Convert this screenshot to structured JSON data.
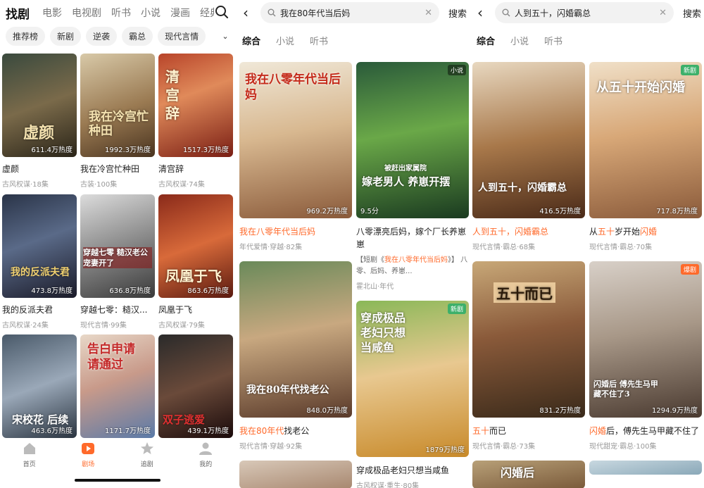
{
  "panel1": {
    "nav_tabs": [
      "找剧",
      "电影",
      "电视剧",
      "听书",
      "小说",
      "漫画",
      "经典"
    ],
    "chips": [
      "推荐榜",
      "新剧",
      "逆袭",
      "霸总",
      "现代言情"
    ],
    "grid": [
      {
        "title": "虚颜",
        "meta": "古风权谋·18集",
        "heat": "611.4万热度",
        "poster_text": "虚颜"
      },
      {
        "title": "我在冷宫忙种田",
        "meta": "古装·100集",
        "heat": "1992.3万热度",
        "poster_text": "我在冷宫忙种田"
      },
      {
        "title": "清宫辞",
        "meta": "古风权谋·74集",
        "heat": "1517.3万热度",
        "poster_text": "清宫辞"
      },
      {
        "title": "我的反派夫君",
        "meta": "古风权谋·24集",
        "heat": "473.8万热度",
        "poster_text": "我的反派夫君"
      },
      {
        "title": "穿越七零：糙汉...",
        "meta": "现代言情·99集",
        "heat": "636.8万热度",
        "poster_text": "穿越七零 糙汉老公宠妻开了"
      },
      {
        "title": "凤凰于飞",
        "meta": "古风权谋·79集",
        "heat": "863.6万热度",
        "poster_text": "凤凰于飞"
      },
      {
        "title": "",
        "meta": "",
        "heat": "463.6万热度",
        "poster_text": "宋校花 后续"
      },
      {
        "title": "",
        "meta": "",
        "heat": "1171.7万热度",
        "poster_text": "告白申请 请通过"
      },
      {
        "title": "",
        "meta": "",
        "heat": "439.1万热度",
        "poster_text": "双子逃爱"
      }
    ],
    "tabbar": [
      {
        "label": "首页",
        "active": false
      },
      {
        "label": "剧场",
        "active": true
      },
      {
        "label": "追剧",
        "active": false
      },
      {
        "label": "我的",
        "active": false
      }
    ]
  },
  "panel2": {
    "query": "我在80年代当后妈",
    "search_label": "搜索",
    "tabs": [
      "综合",
      "小说",
      "听书"
    ],
    "left": [
      {
        "title_parts": [
          [
            "我在八零",
            "hl"
          ],
          [
            "年代当后妈",
            "hl"
          ]
        ],
        "meta": "年代爱情·穿越·82集",
        "heat": "969.2万热度",
        "poster_text": "我在八零年代当后妈",
        "tag": ""
      },
      {
        "title_parts": [
          [
            "我在80年代",
            "hl"
          ],
          [
            "找老公",
            ""
          ]
        ],
        "meta": "现代言情·穿越·92集",
        "heat": "848.0万热度",
        "poster_text": "我在80年代找老公",
        "tag": ""
      }
    ],
    "right": [
      {
        "title": "八零漂亮后妈，嫁个厂长养崽崽",
        "title_hl": "后妈",
        "snippet_prefix": "【短剧《",
        "snippet_hl": "我在八零年代当后妈",
        "snippet_suffix": "》】 八零、后妈、养崽...",
        "meta": "霍北山·年代",
        "heat": "9.5分",
        "poster_text": "嫁老男人 养崽开摆",
        "poster_sub": "被赶出家属院",
        "tag": "小说"
      },
      {
        "title": "穿成极品老妇只想当咸鱼",
        "meta": "古风权谋·重生·80集",
        "heat": "1879万热度",
        "poster_text": "穿成极品老妇只想当咸鱼",
        "tag": "新剧"
      }
    ]
  },
  "panel3": {
    "query": "人到五十，闪婚霸总",
    "search_label": "搜索",
    "tabs": [
      "综合",
      "小说",
      "听书"
    ],
    "left": [
      {
        "title_hl": "人到五十，闪婚霸总",
        "meta": "现代言情·霸总·68集",
        "heat": "416.5万热度",
        "poster_text": "人到五十，闪婚霸总"
      },
      {
        "title_hl": "五十",
        "title_rest": "而已",
        "meta": "现代言情·霸总·73集",
        "heat": "831.2万热度",
        "poster_text": "五十而已"
      },
      {
        "poster_text": "闪婚后"
      }
    ],
    "right": [
      {
        "title_pre": "从",
        "title_hl1": "五十",
        "title_mid": "岁开始",
        "title_hl2": "闪婚",
        "meta": "现代言情·霸总·70集",
        "heat": "717.8万热度",
        "poster_text": "从五十开始闪婚",
        "tag": "新剧"
      },
      {
        "title_hl": "闪婚",
        "title_rest": "后，傅先生马甲藏不住了",
        "meta": "现代甜宠·霸总·100集",
        "heat": "1294.9万热度",
        "poster_text": "闪婚后 傅先生马甲藏不住了3",
        "tag": "爆剧"
      }
    ]
  },
  "colors": {
    "accent": "#ff6a2b",
    "new_tag": "#3db06a"
  }
}
